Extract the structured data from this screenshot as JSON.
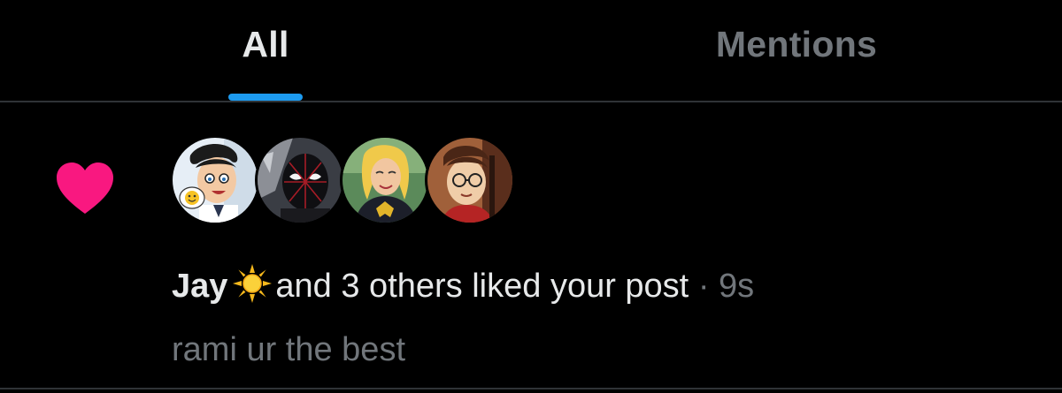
{
  "tabs": [
    {
      "label": "All",
      "selected": true
    },
    {
      "label": "Mentions",
      "selected": false
    }
  ],
  "colors": {
    "background": "#000000",
    "accent": "#1d9bf0",
    "like": "#f91880",
    "secondary_text": "#71767b",
    "primary_text": "#e7e9ea",
    "divider": "#2f3336"
  },
  "notification": {
    "type_icon": "heart-icon",
    "avatars": [
      {
        "name": "avatar-1",
        "icon": "comic-avatar-boy-with-emoji-bubble"
      },
      {
        "name": "avatar-2",
        "icon": "comic-avatar-masked-hero"
      },
      {
        "name": "avatar-3",
        "icon": "comic-avatar-blonde-hero"
      },
      {
        "name": "avatar-4",
        "icon": "comic-avatar-boy-glasses"
      }
    ],
    "actor_name": "Jay",
    "actor_emoji": "sun-icon",
    "action_text": "and 3 others liked your post",
    "separator": "·",
    "time": "9s",
    "post_text": "rami ur the best"
  }
}
